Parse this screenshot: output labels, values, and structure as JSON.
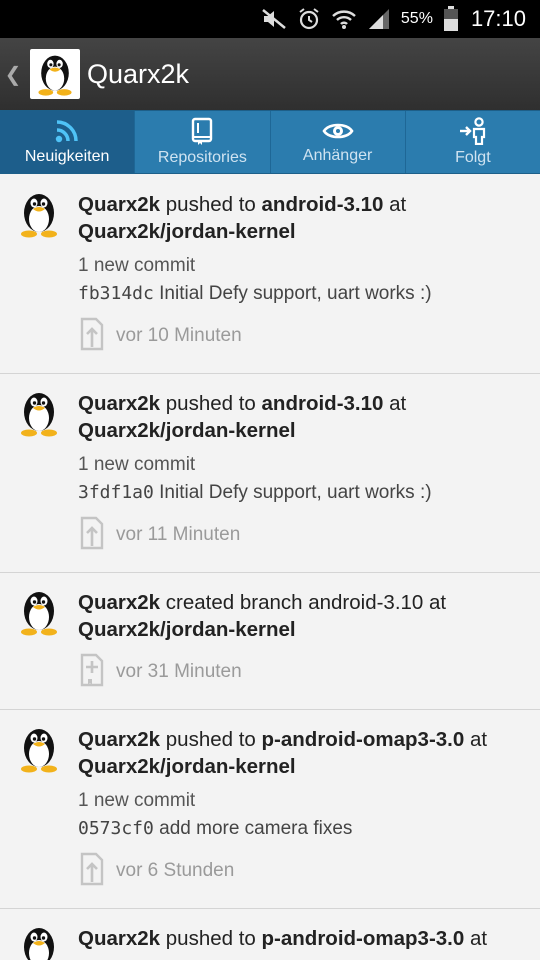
{
  "status_bar": {
    "battery_percent": "55%",
    "clock": "17:10"
  },
  "action_bar": {
    "title": "Quarx2k"
  },
  "tabs": [
    {
      "label": "Neuigkeiten",
      "icon": "rss-icon",
      "active": true
    },
    {
      "label": "Repositories",
      "icon": "book-icon",
      "active": false
    },
    {
      "label": "Anhänger",
      "icon": "eye-icon",
      "active": false
    },
    {
      "label": "Folgt",
      "icon": "follow-icon",
      "active": false
    }
  ],
  "feed": [
    {
      "user": "Quarx2k",
      "action": "pushed to",
      "target": "android-3.10",
      "connector": "at",
      "repo": "Quarx2k/jordan-kernel",
      "commit_count": "1 new commit",
      "commit_sha": "fb314dc",
      "commit_message": "Initial Defy support, uart works :)",
      "time": "vor 10 Minuten",
      "event_icon": "push-icon"
    },
    {
      "user": "Quarx2k",
      "action": "pushed to",
      "target": "android-3.10",
      "connector": "at",
      "repo": "Quarx2k/jordan-kernel",
      "commit_count": "1 new commit",
      "commit_sha": "3fdf1a0",
      "commit_message": "Initial Defy support, uart works :)",
      "time": "vor 11 Minuten",
      "event_icon": "push-icon"
    },
    {
      "user": "Quarx2k",
      "action": "created branch android-3.10",
      "target": "",
      "connector": "at",
      "repo": "Quarx2k/jordan-kernel",
      "time": "vor 31 Minuten",
      "event_icon": "create-branch-icon"
    },
    {
      "user": "Quarx2k",
      "action": "pushed to",
      "target": "p-android-omap3-3.0",
      "connector": "at",
      "repo": "Quarx2k/jordan-kernel",
      "commit_count": "1 new commit",
      "commit_sha": "0573cf0",
      "commit_message": "add more camera fixes",
      "time": "vor 6 Stunden",
      "event_icon": "push-icon"
    },
    {
      "user": "Quarx2k",
      "action": "pushed to",
      "target": "p-android-omap3-3.0",
      "connector": "at",
      "repo": "",
      "time": "",
      "event_icon": "push-icon"
    }
  ]
}
